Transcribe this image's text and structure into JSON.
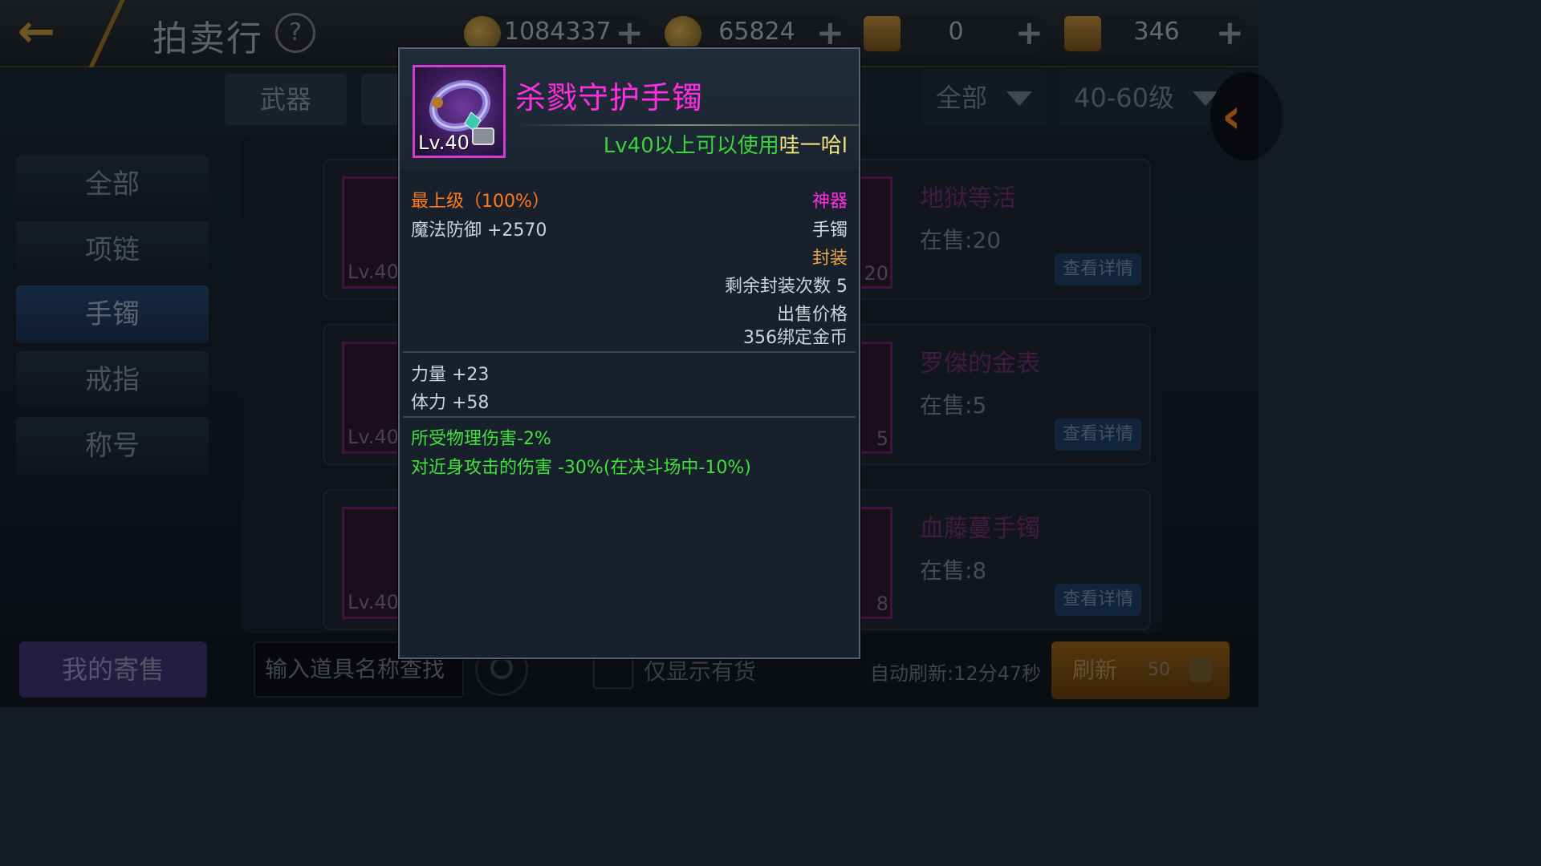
{
  "header": {
    "title": "拍卖行",
    "help": "?",
    "back_icon": "back-arrow-icon",
    "currencies": [
      {
        "icon": "gold-coin-icon",
        "value": "1084337",
        "plus": "+"
      },
      {
        "icon": "bound-coin-icon",
        "value": "65824",
        "plus": "+"
      },
      {
        "icon": "scroll-icon",
        "value": "0",
        "plus": "+"
      },
      {
        "icon": "locked-scroll-icon",
        "value": "346",
        "plus": "+"
      }
    ]
  },
  "category_tabs": [
    {
      "label": "武器"
    }
  ],
  "filters": {
    "type": "全部",
    "level": "40-60级"
  },
  "sidebar": {
    "items": [
      {
        "label": "全部"
      },
      {
        "label": "项链"
      },
      {
        "label": "手镯",
        "active": true
      },
      {
        "label": "戒指"
      },
      {
        "label": "称号"
      }
    ]
  },
  "listings": [
    {
      "lv": "Lv.40",
      "count": "20",
      "name": "地狱等活",
      "on_sale": "在售:20",
      "detail": "查看详情"
    },
    {
      "lv": "Lv.40",
      "count": "5",
      "name": "罗傑的金表",
      "on_sale": "在售:5",
      "detail": "查看详情"
    },
    {
      "lv": "Lv.40",
      "count": "8",
      "name": "血藤蔓手镯",
      "on_sale": "在售:8",
      "detail": "查看详情"
    }
  ],
  "bottom": {
    "my_sale": "我的寄售",
    "search_placeholder": "输入道具名称查找",
    "stock_only": "仅显示有货",
    "auto_refresh": "自动刷新:12分47秒",
    "refresh": "刷新",
    "refresh_cost": "50"
  },
  "tooltip": {
    "item_name": "杀戮守护手镯",
    "item_level": "Lv.40",
    "requirement": "Lv40以上可以使用",
    "owner": "哇一哈l",
    "grade": "最上级（100%）",
    "rarity": "神器",
    "main_stat": "魔法防御 +2570",
    "slot": "手镯",
    "sealed": "封装",
    "seal_remaining": "剩余封装次数 5",
    "sell_price_label": "出售价格",
    "sell_price": "356绑定金币",
    "stats": [
      "力量 +23",
      "体力 +58"
    ],
    "effects": [
      "所受物理伤害-2%",
      "对近身攻击的伤害 -30%(在决斗场中-10%)"
    ],
    "colors": {
      "name": "#ff2ee0",
      "requirement": "#3ad43a",
      "owner": "#f2e27a",
      "grade": "#ff7a1a",
      "effect": "#3ee23a",
      "sealed": "#e8a84a"
    }
  }
}
